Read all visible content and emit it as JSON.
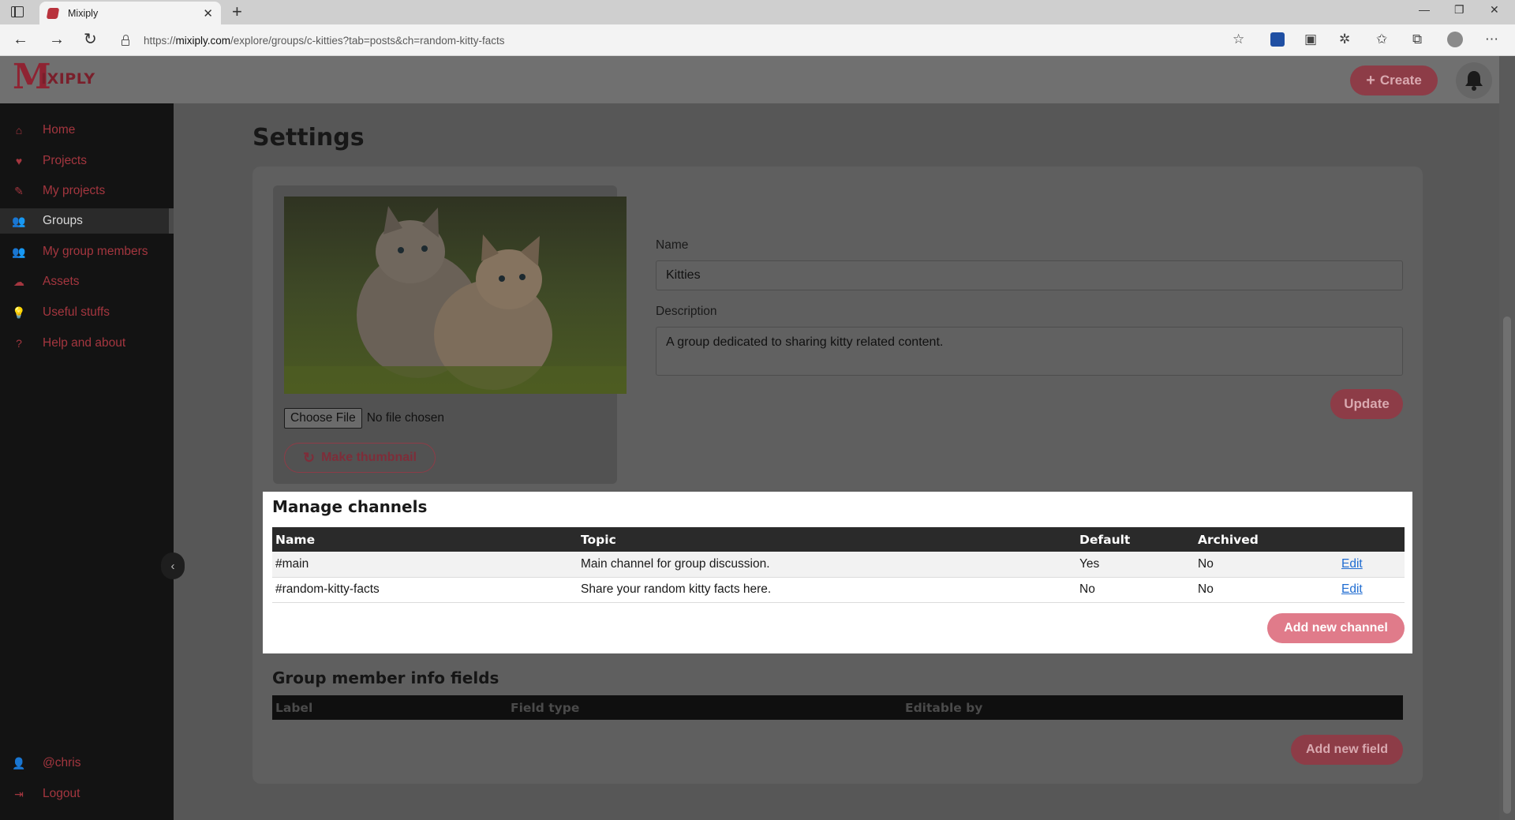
{
  "browser": {
    "tab_title": "Mixiply",
    "url_prefix": "https://",
    "url_domain": "mixiply.com",
    "url_path": "/explore/groups/c-kitties?tab=posts&ch=random-kitty-facts"
  },
  "header": {
    "logo_initial": "M",
    "logo_rest": "IXIPLY",
    "create_label": "Create"
  },
  "sidebar": {
    "items": [
      {
        "label": "Home",
        "icon": "home-icon"
      },
      {
        "label": "Projects",
        "icon": "heart-icon"
      },
      {
        "label": "My projects",
        "icon": "brush-icon"
      },
      {
        "label": "Groups",
        "icon": "users-icon",
        "active": true
      },
      {
        "label": "My group members",
        "icon": "users-group-icon"
      },
      {
        "label": "Assets",
        "icon": "cloud-icon"
      },
      {
        "label": "Useful stuffs",
        "icon": "lightbulb-icon"
      },
      {
        "label": "Help and about",
        "icon": "question-icon"
      }
    ],
    "user": "@chris",
    "logout": "Logout"
  },
  "settings": {
    "title": "Settings",
    "choose_file_label": "Choose File",
    "no_file_text": "No file chosen",
    "make_thumbnail_label": "Make thumbnail",
    "name_label": "Name",
    "name_value": "Kitties",
    "description_label": "Description",
    "description_value": "A group dedicated to sharing kitty related content.",
    "update_label": "Update"
  },
  "channels": {
    "title": "Manage channels",
    "headers": [
      "Name",
      "Topic",
      "Default",
      "Archived",
      ""
    ],
    "rows": [
      {
        "name": "#main",
        "topic": "Main channel for group discussion.",
        "default": "Yes",
        "archived": "No",
        "action": "Edit"
      },
      {
        "name": "#random-kitty-facts",
        "topic": "Share your random kitty facts here.",
        "default": "No",
        "archived": "No",
        "action": "Edit"
      }
    ],
    "add_label": "Add new channel"
  },
  "member_info": {
    "title": "Group member info fields",
    "headers": [
      "Label",
      "Field type",
      "Editable by"
    ],
    "add_label": "Add new field"
  },
  "colors": {
    "brand": "#a4363f",
    "accent_button": "#e07b8a",
    "link": "#1f6cd1"
  }
}
